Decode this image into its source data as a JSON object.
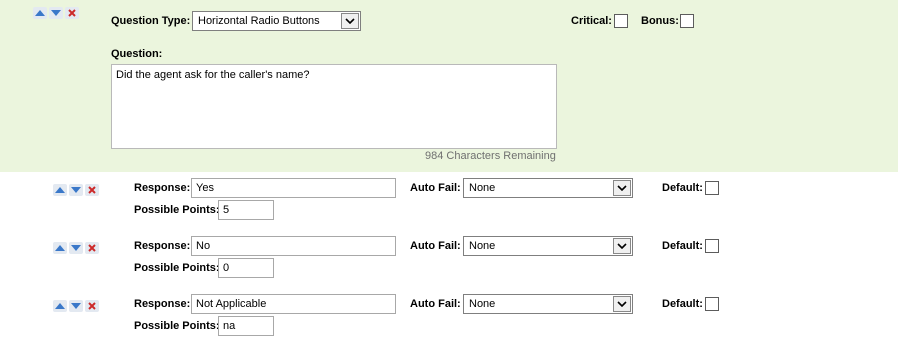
{
  "question": {
    "type_label": "Question Type:",
    "type_value": "Horizontal Radio Buttons",
    "critical_label": "Critical:",
    "bonus_label": "Bonus:",
    "question_label": "Question:",
    "question_text": "Did the agent ask for the caller's name?",
    "remaining_text": "984 Characters Remaining"
  },
  "icons": {
    "up": "arrow-up-icon",
    "down": "arrow-down-icon",
    "delete": "delete-x-icon"
  },
  "colors": {
    "panel_bg": "#ebf5dd",
    "arrow_blue": "#3a78c9",
    "delete_red": "#cc2a2a"
  },
  "labels": {
    "response": "Response:",
    "auto_fail": "Auto Fail:",
    "default": "Default:",
    "possible_points": "Possible Points:"
  },
  "responses": [
    {
      "response": "Yes",
      "auto_fail": "None",
      "points": "5"
    },
    {
      "response": "No",
      "auto_fail": "None",
      "points": "0"
    },
    {
      "response": "Not Applicable",
      "auto_fail": "None",
      "points": "na"
    }
  ]
}
